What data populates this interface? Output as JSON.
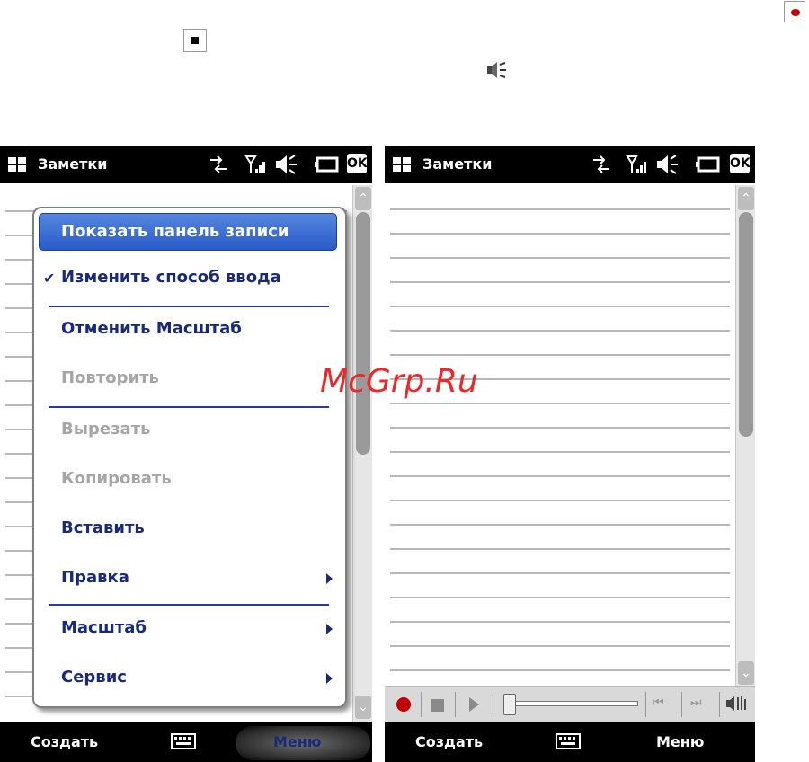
{
  "left_screen": {
    "app_title": "Заметки",
    "ok_label": "OK",
    "menu": {
      "selected": "Показать панель записи",
      "items": [
        {
          "label": "Изменить способ ввода",
          "checked": true,
          "disabled": false
        },
        {
          "label": "Отменить Масштаб",
          "disabled": false
        },
        {
          "label": "Повторить",
          "disabled": true
        },
        {
          "label": "Вырезать",
          "disabled": true
        },
        {
          "label": "Копировать",
          "disabled": true
        },
        {
          "label": "Вставить",
          "disabled": false
        },
        {
          "label": "Правка",
          "disabled": false,
          "submenu": true
        },
        {
          "label": "Масштаб",
          "disabled": false,
          "submenu": true
        },
        {
          "label": "Сервис",
          "disabled": false,
          "submenu": true
        }
      ]
    },
    "softkeys": {
      "left": "Создать",
      "right": "Меню"
    }
  },
  "right_screen": {
    "app_title": "Заметки",
    "ok_label": "OK",
    "softkeys": {
      "left": "Создать",
      "right": "Меню"
    },
    "recording_bar": {
      "buttons": [
        "record-icon",
        "stop-icon",
        "play-icon",
        "previous-icon",
        "next-icon",
        "volume-icon"
      ]
    }
  },
  "legend_icons": [
    "record-icon",
    "stop-icon",
    "speaker-icon"
  ],
  "watermark": "McGrp.Ru",
  "colors": {
    "menu_text": "#1a2a7a",
    "disabled_text": "#a6a6a6",
    "selection": "#2a5bc8",
    "record": "#c00000",
    "watermark": "#ea2a2a"
  }
}
